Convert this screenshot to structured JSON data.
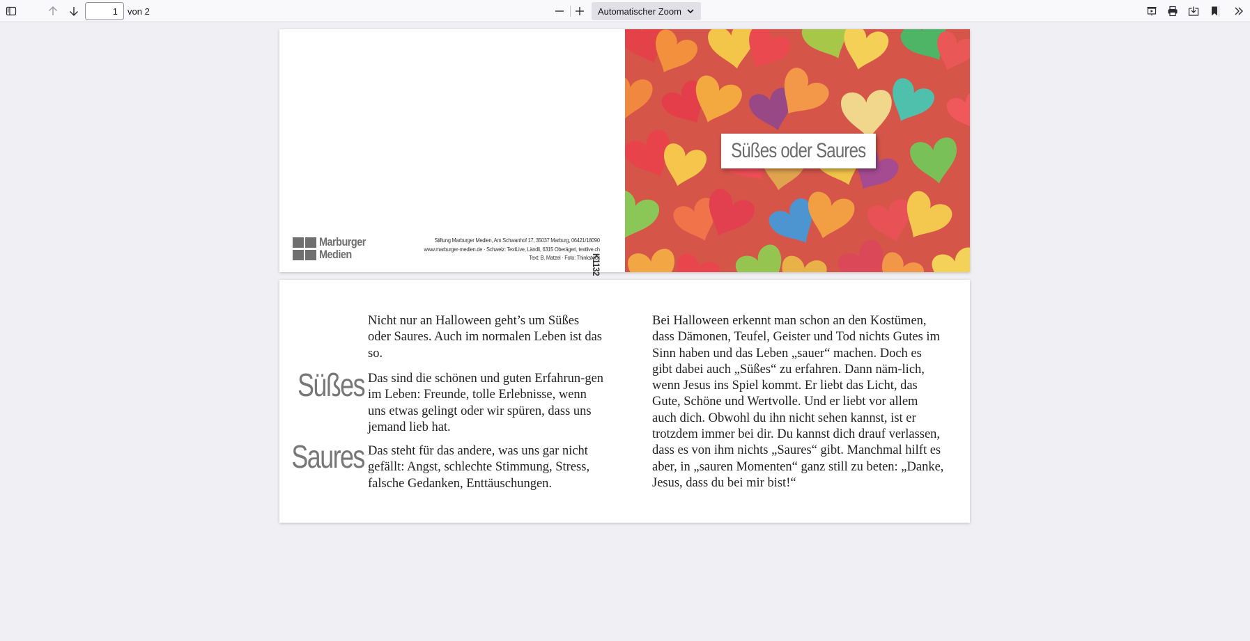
{
  "toolbar": {
    "page_number": "1",
    "page_of": "von 2",
    "zoom_label": "Automatischer Zoom"
  },
  "page1": {
    "logo_text_line1": "Marburger",
    "logo_text_line2": "Medien",
    "imprint_line1": "Stiftung Marburger Medien, Am Schwanhof 17, 35037 Marburg, 06421/18090",
    "imprint_line2": "www.marburger-medien.de · Schweiz: TextLive, Ländli, 6315 Oberägeri, textlive.ch",
    "imprint_line3": "Text: B. Matzel · Foto: Thinkstock",
    "product_code": "K1132",
    "cover_title": "Süßes oder Saures"
  },
  "page2": {
    "left_intro": "Nicht nur an Halloween geht’s um Süßes oder Saures. Auch im normalen Leben ist das so.",
    "sweet_heading": "Süßes",
    "sweet_text": "Das sind die schönen und guten Erfahrun-gen im Leben: Freunde, tolle Erlebnisse, wenn uns etwas gelingt oder wir spüren, dass uns jemand lieb hat.",
    "sour_heading": "Saures",
    "sour_text": "Das steht für das andere, was uns gar nicht gefällt: Angst, schlechte Stimmung, Stress, falsche Gedanken, Enttäuschungen.",
    "right_text": "Bei Halloween erkennt man schon an den Kostümen, dass Dämonen, Teufel, Geister und Tod nichts Gutes im Sinn haben und das Leben „sauer“ machen. Doch es gibt dabei auch „Süßes“ zu erfahren. Dann näm-lich, wenn Jesus ins Spiel kommt. Er liebt das Licht, das Gute, Schöne und Wertvolle. Und er liebt vor allem auch dich. Obwohl du ihn nicht sehen kannst, ist er trotzdem immer bei dir. Du kannst dich drauf verlassen, dass es von ihm nichts „Saures“ gibt. Manchmal hilft es aber, in „sauren Momenten“ ganz still zu beten: „Danke, Jesus, dass du bei mir bist!“"
  }
}
